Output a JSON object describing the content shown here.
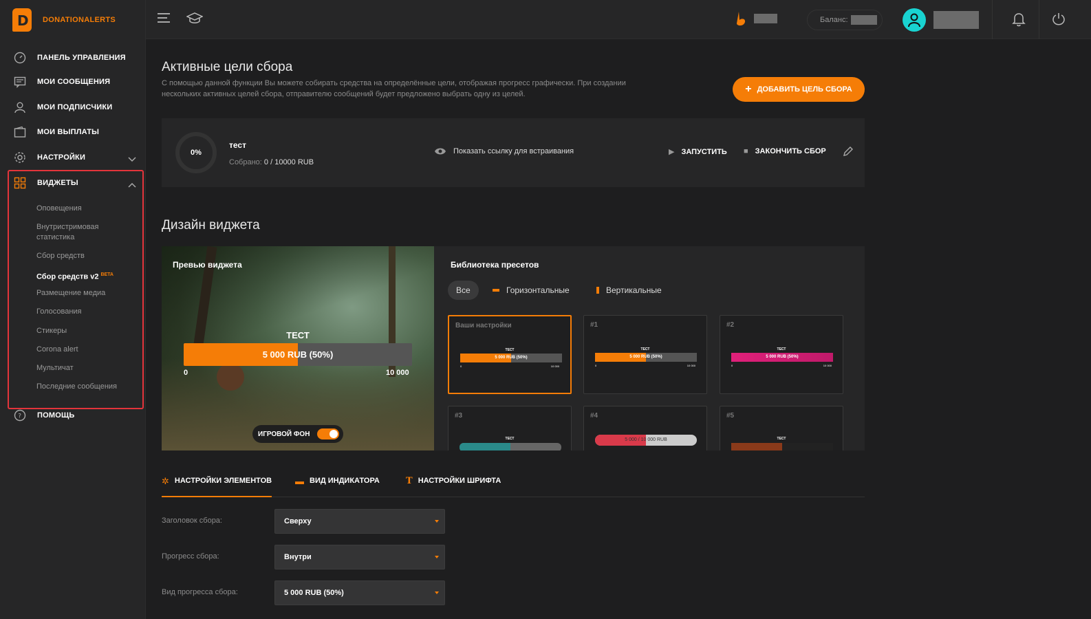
{
  "logo": {
    "text": "DONATIONALERTS"
  },
  "sidebar": {
    "items": [
      {
        "label": "ПАНЕЛЬ УПРАВЛЕНИЯ",
        "icon": "dashboard-icon"
      },
      {
        "label": "МОИ СООБЩЕНИЯ",
        "icon": "messages-icon"
      },
      {
        "label": "МОИ ПОДПИСЧИКИ",
        "icon": "user-icon"
      },
      {
        "label": "МОИ ВЫПЛАТЫ",
        "icon": "wallet-icon"
      },
      {
        "label": "НАСТРОЙКИ",
        "icon": "gear-icon"
      },
      {
        "label": "ВИДЖЕТЫ",
        "icon": "widgets-grid-icon"
      },
      {
        "label": "ПОМОЩЬ",
        "icon": "help-icon"
      }
    ],
    "widgets_sub": [
      {
        "label": "Оповещения"
      },
      {
        "label": "Внутристримовая статистика"
      },
      {
        "label": "Сбор средств"
      },
      {
        "label": "Сбор средств v2",
        "badge": "BETA"
      },
      {
        "label": "Размещение медиа"
      },
      {
        "label": "Голосования"
      },
      {
        "label": "Стикеры"
      },
      {
        "label": "Corona alert"
      },
      {
        "label": "Мультичат"
      },
      {
        "label": "Последние сообщения"
      }
    ]
  },
  "topbar": {
    "balance_label": "Баланс:"
  },
  "page": {
    "title": "Активные цели сбора",
    "description": "С помощью данной функции Вы можете собирать средства на определённые цели, отображая прогресс графически. При создании нескольких активных целей сбора, отправителю сообщений будет предложено выбрать одну из целей.",
    "add_button": "ДОБАВИТЬ ЦЕЛЬ СБОРА"
  },
  "goal": {
    "percent": "0%",
    "name": "тест",
    "collected_label": "Собрано:",
    "collected_value": "0 / 10000 RUB",
    "embed_link": "Показать ссылку для встраивания",
    "start": "ЗАПУСТИТЬ",
    "finish": "ЗАКОНЧИТЬ СБОР"
  },
  "design": {
    "title": "Дизайн виджета",
    "preview": {
      "title": "Превью виджета",
      "bar_title": "ТЕСТ",
      "bar_text": "5 000 RUB (50%)",
      "progress": 0.5,
      "min": "0",
      "max": "10 000",
      "game_bg": "ИГРОВОЙ ФОН"
    },
    "presets": {
      "title": "Библиотека пресетов",
      "filters": [
        "Все",
        "Горизонтальные",
        "Вертикальные"
      ],
      "items": [
        {
          "label": "Ваши настройки",
          "bar_title": "ТЕСТ",
          "bar_text": "5 000 RUB (50%)",
          "min": "0",
          "max": "10 000",
          "color": "#f57d07"
        },
        {
          "label": "#1",
          "bar_title": "ТЕСТ",
          "bar_text": "5 000 RUB (50%)",
          "min": "0",
          "max": "10 000",
          "color": "#f57d07"
        },
        {
          "label": "#2",
          "bar_title": "ТЕСТ",
          "bar_text": "5 000 RUB (50%)",
          "min": "0",
          "max": "10 000",
          "color": "#e0207a"
        },
        {
          "label": "#3",
          "bar_title": "ТЕСТ",
          "color": "#2a8a8a"
        },
        {
          "label": "#4",
          "bar_text": "5 000 / 10 000 RUB",
          "color": "#d93a4a"
        },
        {
          "label": "#5",
          "bar_title": "ТЕСТ",
          "color": "#8a3a1a"
        }
      ]
    }
  },
  "tabs": [
    {
      "label": "НАСТРОЙКИ ЭЛЕМЕНТОВ",
      "icon": "gear-icon"
    },
    {
      "label": "ВИД ИНДИКАТОРА",
      "icon": "indicator-icon"
    },
    {
      "label": "НАСТРОЙКИ ШРИФТА",
      "icon": "font-icon"
    }
  ],
  "form": [
    {
      "label": "Заголовок сбора:",
      "value": "Сверху"
    },
    {
      "label": "Прогресс сбора:",
      "value": "Внутри"
    },
    {
      "label": "Вид прогресса сбора:",
      "value": "5 000 RUB (50%)"
    }
  ],
  "colors": {
    "accent": "#f57d07",
    "highlight_border": "#e4343b",
    "avatar": "#19d3d1"
  }
}
